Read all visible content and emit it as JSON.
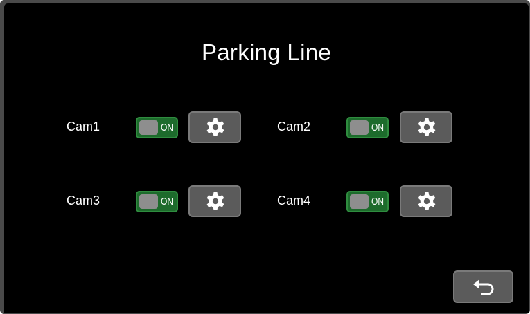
{
  "page": {
    "title": "Parking Line"
  },
  "cameras": [
    {
      "label": "Cam1",
      "state": "ON"
    },
    {
      "label": "Cam2",
      "state": "ON"
    },
    {
      "label": "Cam3",
      "state": "ON"
    },
    {
      "label": "Cam4",
      "state": "ON"
    }
  ],
  "icons": {
    "settings": "gear-icon",
    "back": "back-arrow-icon"
  },
  "colors": {
    "background": "#000000",
    "toggle_on": "#1d6b2c",
    "button": "#5b5b5b",
    "text": "#ffffff"
  }
}
